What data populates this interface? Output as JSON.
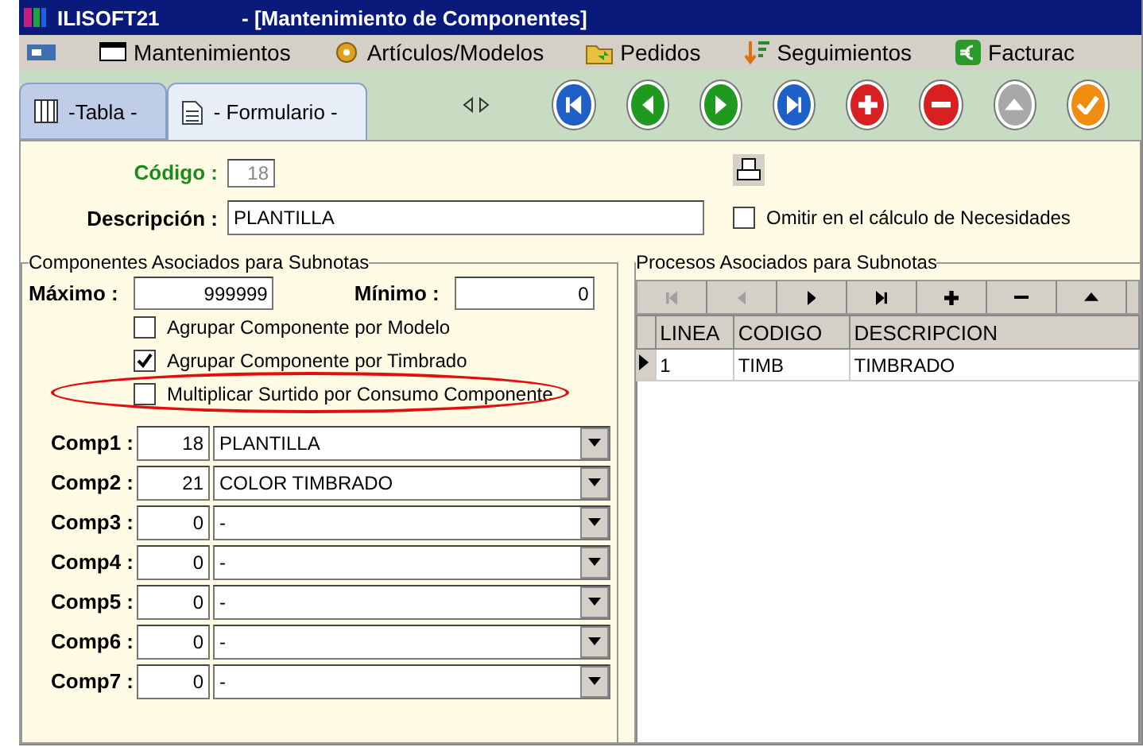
{
  "window": {
    "app_name": "ILISOFT21",
    "title": "- [Mantenimiento de Componentes]"
  },
  "menu": [
    {
      "label": "Mantenimientos",
      "kind": "window"
    },
    {
      "label": "Artículos/Modelos",
      "kind": "gear"
    },
    {
      "label": "Pedidos",
      "kind": "folder"
    },
    {
      "label": "Seguimientos",
      "kind": "sort"
    },
    {
      "label": "Facturac",
      "kind": "euro"
    }
  ],
  "tabs": [
    {
      "label": "-Tabla -",
      "kind": "table",
      "selected": false
    },
    {
      "label": "- Formulario -",
      "kind": "form",
      "selected": true
    }
  ],
  "toolbar": [
    {
      "kind": "first",
      "color": "#1f5fc8"
    },
    {
      "kind": "prev",
      "color": "#1f9a1f"
    },
    {
      "kind": "next",
      "color": "#1f9a1f"
    },
    {
      "kind": "last",
      "color": "#1f5fc8"
    },
    {
      "kind": "add",
      "color": "#d82020"
    },
    {
      "kind": "delete",
      "color": "#d82020"
    },
    {
      "kind": "up",
      "color": "#a8a8a8"
    },
    {
      "kind": "confirm",
      "color": "#f08c10"
    }
  ],
  "form": {
    "codigo_label": "Código :",
    "codigo_value": "18",
    "descripcion_label": "Descripción :",
    "descripcion_value": "PLANTILLA",
    "omitir": {
      "label": "Omitir en el cálculo de Necesidades",
      "checked": false
    }
  },
  "componentes": {
    "title": "Componentes Asociados para Subnotas",
    "maximo_label": "Máximo :",
    "maximo_value": "999999",
    "minimo_label": "Mínimo :",
    "minimo_value": "0",
    "options": [
      {
        "label": "Agrupar Componente por Modelo",
        "checked": false,
        "circled": false
      },
      {
        "label": "Agrupar Componente por Timbrado",
        "checked": true,
        "circled": false
      },
      {
        "label": "Multiplicar Surtido por Consumo Componente",
        "checked": false,
        "circled": true
      }
    ],
    "rows": [
      {
        "label": "Comp1 :",
        "number": "18",
        "value": "PLANTILLA"
      },
      {
        "label": "Comp2 :",
        "number": "21",
        "value": "COLOR TIMBRADO"
      },
      {
        "label": "Comp3 :",
        "number": "0",
        "value": "-"
      },
      {
        "label": "Comp4 :",
        "number": "0",
        "value": "-"
      },
      {
        "label": "Comp5 :",
        "number": "0",
        "value": "-"
      },
      {
        "label": "Comp6 :",
        "number": "0",
        "value": "-"
      },
      {
        "label": "Comp7 :",
        "number": "0",
        "value": "-"
      }
    ]
  },
  "procesos": {
    "title": "Procesos Asociados para Subnotas",
    "navigator": [
      {
        "kind": "first",
        "disabled": true
      },
      {
        "kind": "prev",
        "disabled": true
      },
      {
        "kind": "next",
        "disabled": false
      },
      {
        "kind": "last",
        "disabled": false
      },
      {
        "kind": "add",
        "disabled": false
      },
      {
        "kind": "delete",
        "disabled": false
      },
      {
        "kind": "up",
        "disabled": false
      }
    ],
    "columns": [
      "LINEA",
      "CODIGO",
      "DESCRIPCION"
    ],
    "rows": [
      {
        "cells": [
          "1",
          "TIMB",
          "TIMBRADO"
        ],
        "selected": true
      }
    ]
  }
}
